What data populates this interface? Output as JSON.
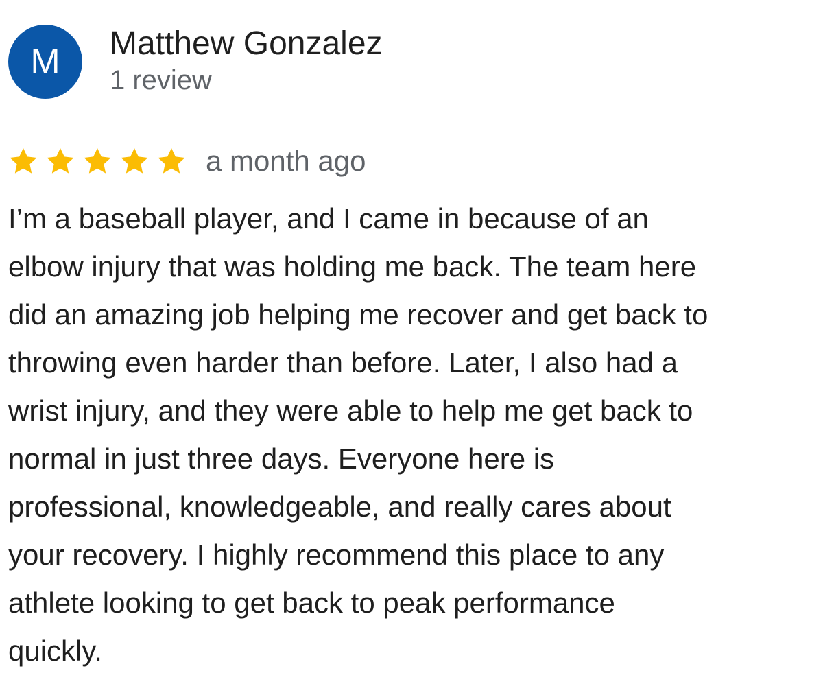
{
  "reviewer": {
    "avatar_letter": "M",
    "avatar_color": "#0b57a8",
    "name": "Matthew Gonzalez",
    "review_count_text": "1 review"
  },
  "review": {
    "rating": 5,
    "max_rating": 5,
    "star_color": "#fbbc04",
    "star_icon": "star-icon",
    "date_text": "a month ago",
    "body_lines": [
      "I’m a baseball player, and I came in because of an",
      "elbow injury that was holding me back. The team here",
      "did an amazing job helping me recover and get back to",
      "throwing even harder than before. Later, I also had a",
      "wrist injury, and they were able to help me get back to",
      "normal in just three days. Everyone here is",
      "professional, knowledgeable, and really cares about",
      "your recovery. I highly recommend this place to any",
      "athlete looking to get back to peak performance",
      "quickly."
    ]
  }
}
